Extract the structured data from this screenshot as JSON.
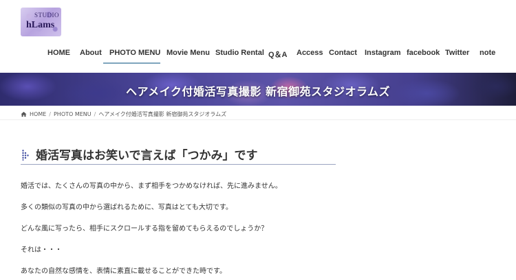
{
  "header": {
    "logo": {
      "studio": "STUDIO",
      "name": "hLams"
    },
    "nav": [
      {
        "label": "HOME"
      },
      {
        "label": "About"
      },
      {
        "label": "PHOTO MENU"
      },
      {
        "label": "Movie Menu"
      },
      {
        "label": "Studio Rental"
      },
      {
        "label": "Q＆A"
      },
      {
        "label": "Access"
      },
      {
        "label": "Contact"
      },
      {
        "label": "Instagram"
      },
      {
        "label": "facebook"
      },
      {
        "label": "Twitter"
      },
      {
        "label": "note"
      }
    ],
    "active_nav": "PHOTO MENU",
    "accent_color": "#7ea4bd"
  },
  "banner": {
    "title": "ヘアメイク付婚活写真撮影 新宿御苑スタジオラムズ"
  },
  "breadcrumb": {
    "items": [
      "HOME",
      "PHOTO MENU",
      "ヘアメイク付婚活写真撮影 新宿御苑スタジオラムズ"
    ],
    "separator": "/"
  },
  "content": {
    "heading": "婚活写真はお笑いで言えば「つかみ」です",
    "paragraphs": [
      "婚活では、たくさんの写真の中から、まず相手をつかめなければ、先に進みません。",
      "多くの類似の写真の中から選ばれるために、写真はとても大切です。",
      "どんな風に写ったら、相手にスクロールする指を留めてもらえるのでしょうか？",
      "それは・・・",
      "あなたの自然な感情を、表情に素直に載せることができた時です。"
    ],
    "heading_icon_color": "#3d4aa0"
  }
}
